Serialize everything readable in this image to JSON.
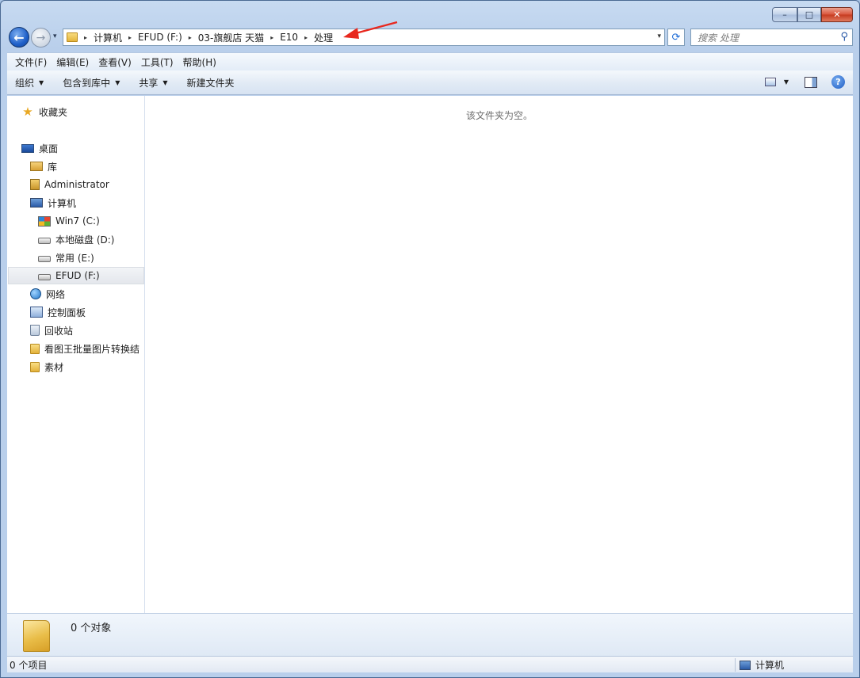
{
  "window": {
    "caption_buttons": {
      "minimize": "–",
      "maximize": "□",
      "close": "✕"
    }
  },
  "nav": {
    "back_glyph": "←",
    "forward_glyph": "→",
    "dropdown_glyph": "▾"
  },
  "address": {
    "crumbs": [
      "计算机",
      "EFUD (F:)",
      "03-旗舰店 天猫",
      "E10",
      "处理"
    ],
    "separator": "▸",
    "dropdown_glyph": "▾"
  },
  "refresh_glyph": "⟳",
  "search": {
    "placeholder": "搜索 处理",
    "icon_glyph": "⚲"
  },
  "menubar": {
    "items": [
      "文件(F)",
      "编辑(E)",
      "查看(V)",
      "工具(T)",
      "帮助(H)"
    ]
  },
  "toolbar": {
    "organize": "组织",
    "include_library": "包含到库中",
    "share": "共享",
    "new_folder": "新建文件夹",
    "dropdown_glyph": "▼",
    "help_glyph": "?"
  },
  "sidebar": {
    "favorites": "收藏夹",
    "desktop": "桌面",
    "library": "库",
    "administrator": "Administrator",
    "computer": "计算机",
    "drive_c": "Win7 (C:)",
    "drive_d": "本地磁盘 (D:)",
    "drive_e": "常用 (E:)",
    "drive_f": "EFUD (F:)",
    "network": "网络",
    "control_panel": "控制面板",
    "recycle_bin": "回收站",
    "folder_1": "看图王批量图片转换结",
    "folder_2": "素材"
  },
  "file_pane": {
    "empty_message": "该文件夹为空。"
  },
  "details": {
    "object_count": "0 个对象"
  },
  "statusbar": {
    "item_count": "0 个项目",
    "location": "计算机"
  },
  "colors": {
    "annotation_arrow": "#e8281e",
    "accent": "#1e5fc8"
  }
}
